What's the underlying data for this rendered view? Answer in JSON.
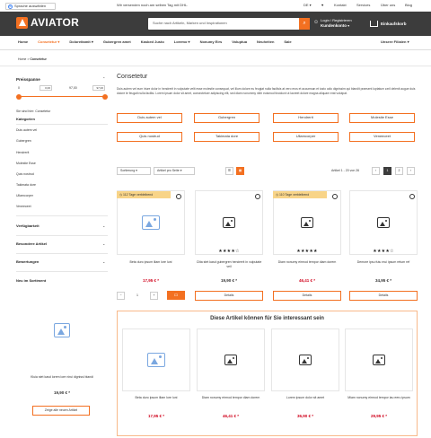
{
  "topbar": {
    "language": "Sprache auswählen",
    "message": "Wir versenden noch am selben Tag mit DHL.",
    "lang_code": "DE",
    "links": [
      "Kontakt",
      "Services",
      "Über uns",
      "Blog"
    ]
  },
  "header": {
    "logo": "AVIATOR",
    "search_placeholder": "Suche nach Artikeln, Marken und Inspirationen",
    "login_line1": "Login / Registrieren",
    "login_line2": "Kundenkonto",
    "cart_label": "Einkaufskorb",
    "cart_count": "0"
  },
  "nav": {
    "items": [
      "Home",
      "Consetetur",
      "Doloreitamit",
      "Gubergren amet",
      "Kasked Justo",
      "Loremo",
      "Nonumy Eirs",
      "Voluptua",
      "Neuheiten",
      "Sale"
    ],
    "right": "Unsere Filialen"
  },
  "breadcrumb": {
    "home": "Home",
    "current": "Consetetur"
  },
  "sidebar": {
    "price_title": "Preisspanne",
    "price_min_label": "0",
    "price_max_label": "97,00",
    "price_min_val": "0,00",
    "price_max_val": "97,00",
    "here_text": "Sie sind hier: Consetetur",
    "categories_title": "Kategorien",
    "categories": [
      "Duis autem vel",
      "Gubergren",
      "Hendrerit",
      "Molestie Esse",
      "Quis nostrud",
      "Takimata dore",
      "Ullamcorper",
      "Veneeceet"
    ],
    "filters": [
      "Verfügbarkeit",
      "Besondere Artikel",
      "Bewertungen"
    ],
    "new_title": "Neu im Sortiment",
    "new_name": "Kluia stet kasd lorem lore nirui dignissi blandi",
    "new_price": "19,90 € *",
    "new_btn": "Zeige alle neuen Artikel"
  },
  "content": {
    "title": "Consetetur",
    "description": "Duis autem vel eum iriure dolor in hendrerit in vulputate velit esse molestie consequat, vel illum dolore eu feugiat nulla facilisis at vero eros et accumsan et iusto odio dignissim qui blandit praesent luptatum zzril delenit augue duis dolore te feugait nulla facilisi. Lorem ipsum dolor sit amet, consectetuer adipiscing elit, sed diam nonummy nibh euismod tincidunt ut laoreet dolore magna aliquam erat volutpat.",
    "tags": [
      "Duis autem vel",
      "Gubergren",
      "Hendrerit",
      "Molestie Esse",
      "Quis nostrud",
      "Takimata dore",
      "Ullamcorper",
      "Veneeceet"
    ],
    "sort_label": "Sortierung",
    "per_page_label": "Artikel pro Seite",
    "count_text": "Artikel 1 - 20 von 26",
    "pages": [
      "1",
      "2"
    ]
  },
  "products": [
    {
      "badge": "112 Tage verbleibend",
      "name": "Beta duro ipsum illam lore luni",
      "stars": 0,
      "price": "17,95 € *",
      "price_red": true,
      "action": "cart",
      "qty": "1"
    },
    {
      "badge": "",
      "name": "Clita stet kasd gubergren hendrerit in vulputate veil",
      "stars": 4,
      "price": "19,90 € *",
      "price_red": false,
      "action": "Details"
    },
    {
      "badge": "110 Tage verbleibend",
      "name": "Diam nonumy eirmod tempor diam dorem",
      "stars": 5,
      "price": "46,41 € *",
      "price_red": true,
      "action": "Details"
    },
    {
      "badge": "",
      "name": "Demore ipsu futu mui ipsum retum ref",
      "stars": 4,
      "price": "34,95 € *",
      "price_red": false,
      "action": "Details"
    }
  ],
  "reco": {
    "title": "Diese Artikel können für Sie interessant sein",
    "items": [
      {
        "name": "Beta duro ipsum illam lore luni",
        "price": "17,95 € *"
      },
      {
        "name": "Diam nonumy eirmod tempor diam dorem",
        "price": "46,41 € *"
      },
      {
        "name": "Lorem ipsum dolor sit amet",
        "price": "36,90 € *"
      },
      {
        "name": "Miam nonumy eirmod tempor iau eeru ipsum",
        "price": "29,95 € *"
      }
    ]
  },
  "colors": {
    "accent": "#f37021",
    "header": "#3c3c3c",
    "price_red": "#d0021b",
    "badge": "#f8d488"
  }
}
